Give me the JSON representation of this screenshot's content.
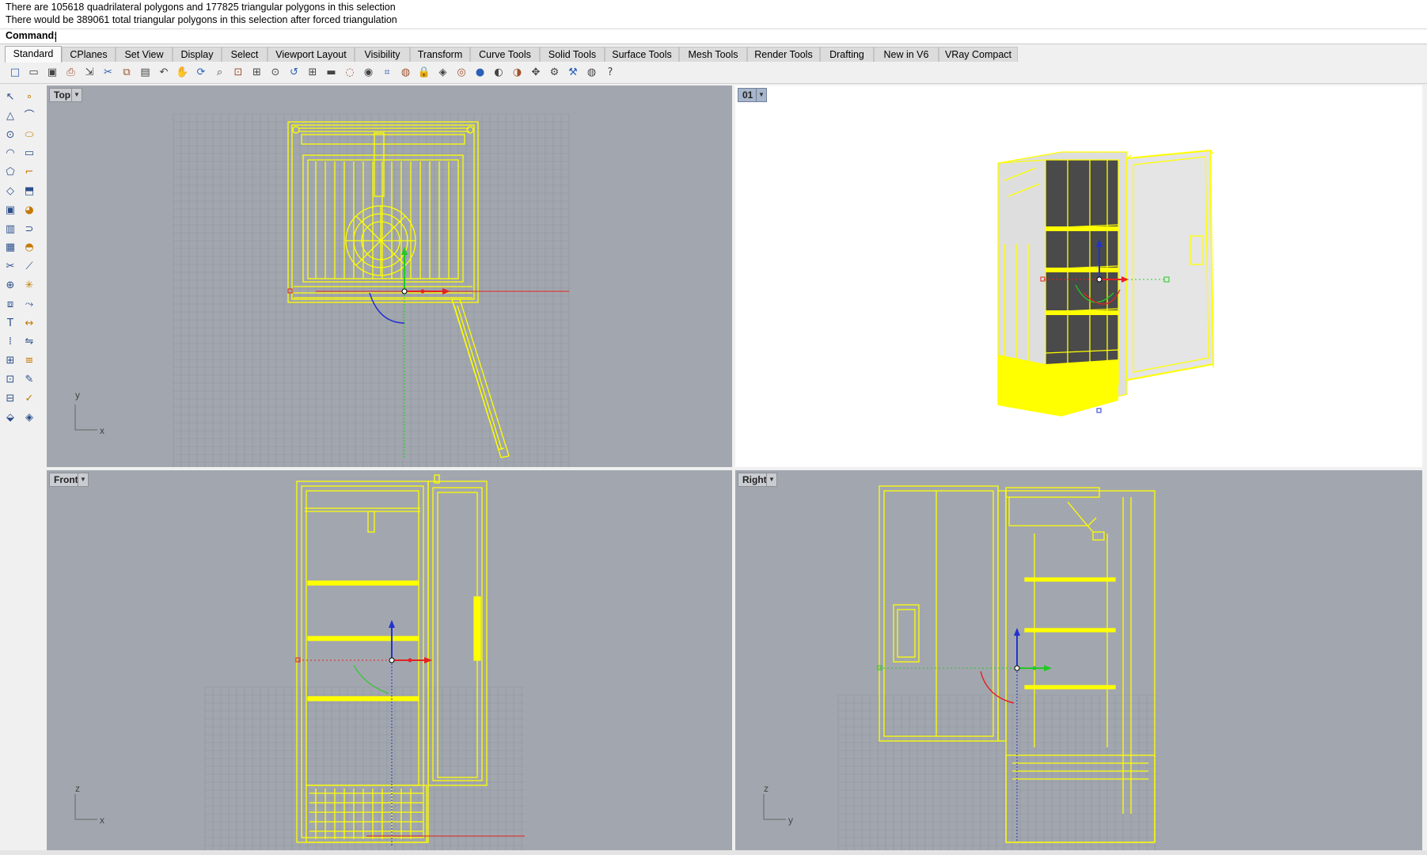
{
  "history": {
    "line1": "There are 105618 quadrilateral polygons and 177825 triangular polygons in this selection",
    "line2": "There would be 389061 total triangular polygons in this selection after forced triangulation"
  },
  "command": {
    "label": "Command:",
    "value": ""
  },
  "tabs": [
    {
      "label": "Standard",
      "active": true
    },
    {
      "label": "CPlanes"
    },
    {
      "label": "Set View"
    },
    {
      "label": "Display"
    },
    {
      "label": "Select"
    },
    {
      "label": "Viewport Layout"
    },
    {
      "label": "Visibility"
    },
    {
      "label": "Transform"
    },
    {
      "label": "Curve Tools"
    },
    {
      "label": "Solid Tools"
    },
    {
      "label": "Surface Tools"
    },
    {
      "label": "Mesh Tools"
    },
    {
      "label": "Render Tools"
    },
    {
      "label": "Drafting"
    },
    {
      "label": "New in V6"
    },
    {
      "label": "VRay Compact"
    }
  ],
  "toolbar_icons": [
    "new-icon",
    "open-icon",
    "save-icon",
    "print-icon",
    "import-icon",
    "cut-icon",
    "copy-icon",
    "paste-icon",
    "undo-icon",
    "pan-icon",
    "rotate-view-icon",
    "zoom-icon",
    "zoom-window-icon",
    "zoom-extents-icon",
    "zoom-selected-icon",
    "undo-view-icon",
    "four-viewports-icon",
    "car-icon",
    "hide-icon",
    "show-icon",
    "grid-snap-icon",
    "light-icon",
    "lock-icon",
    "materials-icon",
    "color-wheel-icon",
    "render-icon",
    "sphere-icon",
    "shaded-sphere-icon",
    "move-icon",
    "settings-icon",
    "options-icon",
    "globe-icon",
    "help-icon"
  ],
  "left_tools": [
    "select-arrow-icon",
    "point-icon",
    "polyline-icon",
    "curve-icon",
    "circle-icon",
    "ellipse-icon",
    "arc-icon",
    "rectangle-icon",
    "polygon-icon",
    "fillet-icon",
    "surface-icon",
    "extrude-icon",
    "box-icon",
    "sphere-tool-icon",
    "cylinder-icon",
    "pipe-icon",
    "mesh-icon",
    "boolean-icon",
    "trim-icon",
    "split-icon",
    "join-icon",
    "explode-icon",
    "offset-icon",
    "blend-icon",
    "text-icon",
    "dimension-icon",
    "array-icon",
    "mirror-icon",
    "group-icon",
    "layer-icon",
    "grid-icon",
    "analyze-icon",
    "cplane-icon",
    "check-icon",
    "properties-icon",
    "render-tool-icon"
  ],
  "viewports": {
    "top": {
      "label": "Top",
      "axis_a": "y",
      "axis_b": "x"
    },
    "persp": {
      "label": "01"
    },
    "front": {
      "label": "Front",
      "axis_a": "z",
      "axis_b": "x"
    },
    "right": {
      "label": "Right",
      "axis_a": "z",
      "axis_b": "y"
    }
  },
  "colors": {
    "wire": "#ffff00",
    "viewport_bg": "#a2a7af",
    "grid": "#8f949c",
    "x_axis": "#e32222",
    "y_axis": "#22c922",
    "z_axis": "#2233cc"
  }
}
